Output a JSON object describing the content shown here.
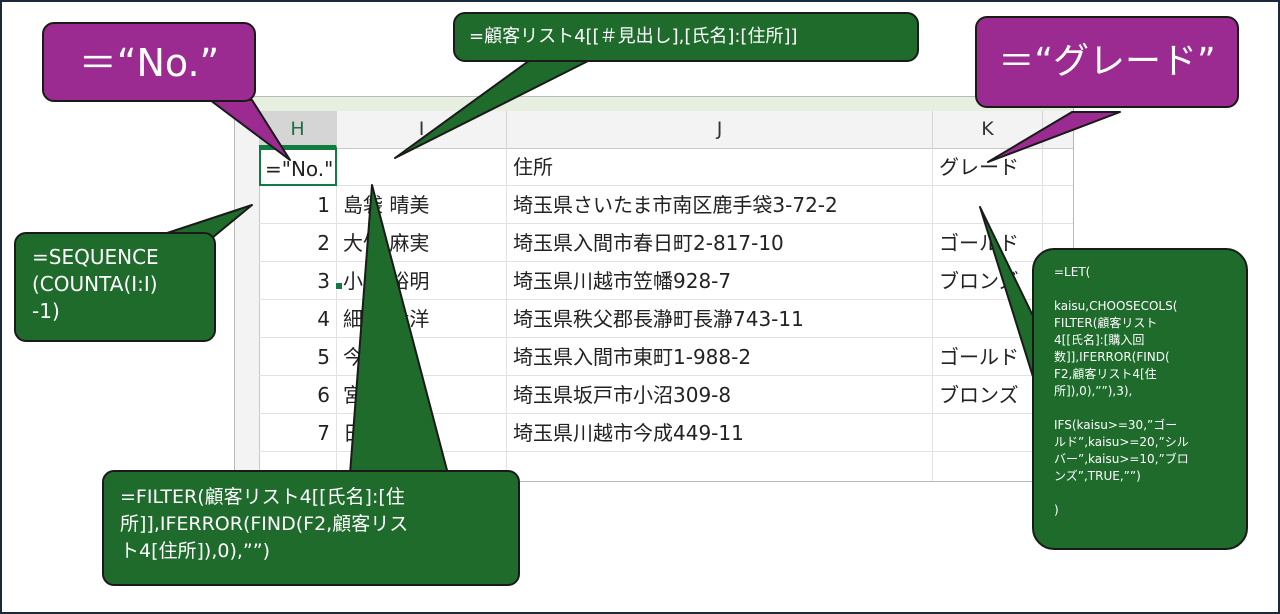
{
  "sheet": {
    "columns": [
      {
        "id": "H",
        "label": "H"
      },
      {
        "id": "I",
        "label": "I"
      },
      {
        "id": "J",
        "label": "J"
      },
      {
        "id": "K",
        "label": "K"
      }
    ],
    "rows": [
      {
        "h": "=\"No.\"",
        "i": "",
        "j": "住所",
        "k": "グレード"
      },
      {
        "h": "1",
        "i": "島袋 晴美",
        "j": "埼玉県さいたま市南区鹿手袋3-72-2",
        "k": ""
      },
      {
        "h": "2",
        "i": "大竹 麻実",
        "j": "埼玉県入間市春日町2-817-10",
        "k": "ゴールド"
      },
      {
        "h": "3",
        "i": "小池 裕明",
        "j": "埼玉県川越市笠幡928-7",
        "k": "ブロンズ"
      },
      {
        "h": "4",
        "i": "細谷 貴洋",
        "j": "埼玉県秩父郡長瀞町長瀞743-11",
        "k": ""
      },
      {
        "h": "5",
        "i": "今村 三",
        "j": "埼玉県入間市東町1-988-2",
        "k": "ゴールド"
      },
      {
        "h": "6",
        "i": "宮 浩",
        "j": "埼玉県坂戸市小沼309-8",
        "k": "ブロンズ"
      },
      {
        "h": "7",
        "i": "日",
        "j": "埼玉県川越市今成449-11",
        "k": ""
      },
      {
        "h": "",
        "i": "",
        "j": "",
        "k": ""
      }
    ]
  },
  "callouts": {
    "no": "＝“No.”",
    "header_formula": "=顧客リスト4[[＃見出し],[氏名]:[住所]]",
    "grade": "＝“グレード”",
    "sequence": "=SEQUENCE\n(COUNTA(I:I)\n-1)",
    "filter": "=FILTER(顧客リスト4[[氏名]:[住\n所]],IFERROR(FIND(F2,顧客リス\nト4[住所]),0),””)",
    "let": "=LET(\n\nkaisu,CHOOSECOLS(\nFILTER(顧客リスト\n4[[氏名]:[購入回\n数]],IFERROR(FIND(\nF2,顧客リスト4[住\n所]),0),””),3),\n\nIFS(kaisu>=30,”ゴー\nルド”,kaisu>=20,”シル\nバー”,kaisu>=10,”ブロ\nンズ”,TRUE,””)\n\n)"
  },
  "colors": {
    "callout_green": "#1e6b2c",
    "callout_purple": "#9b2a91",
    "excel_green": "#107c41"
  }
}
